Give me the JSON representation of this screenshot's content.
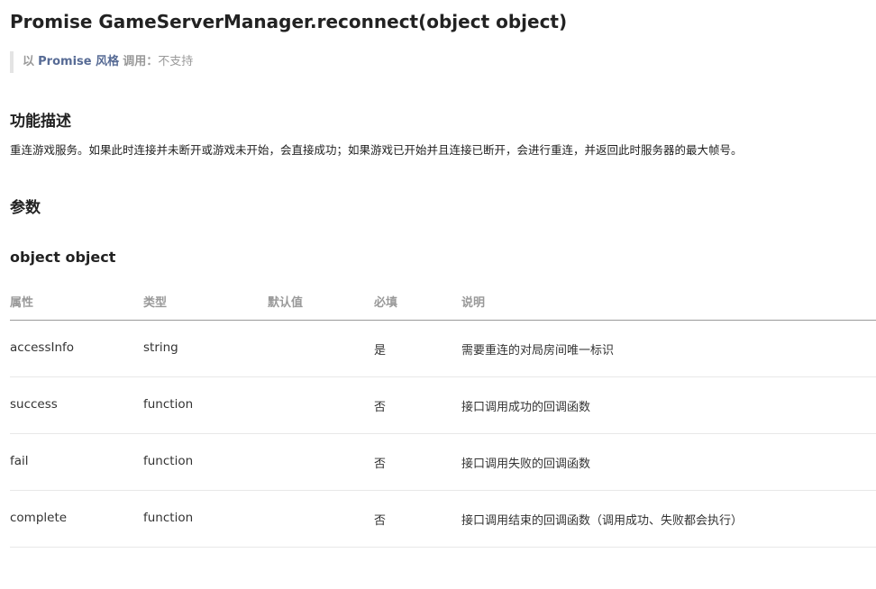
{
  "page": {
    "title": "Promise GameServerManager.reconnect(object object)",
    "promise_note": {
      "prefix": "以",
      "link": "Promise 风格",
      "label": "调用：",
      "value": "不支持"
    },
    "description_heading": "功能描述",
    "description": "重连游戏服务。如果此时连接并未断开或游戏未开始，会直接成功；如果游戏已开始并且连接已断开，会进行重连，并返回此时服务器的最大帧号。",
    "params_heading": "参数",
    "object_heading": "object object"
  },
  "table": {
    "headers": [
      "属性",
      "类型",
      "默认值",
      "必填",
      "说明"
    ],
    "rows": [
      {
        "name": "accessInfo",
        "type": "string",
        "default": "",
        "required": "是",
        "desc": "需要重连的对局房间唯一标识"
      },
      {
        "name": "success",
        "type": "function",
        "default": "",
        "required": "否",
        "desc": "接口调用成功的回调函数"
      },
      {
        "name": "fail",
        "type": "function",
        "default": "",
        "required": "否",
        "desc": "接口调用失败的回调函数"
      },
      {
        "name": "complete",
        "type": "function",
        "default": "",
        "required": "否",
        "desc": "接口调用结束的回调函数（调用成功、失败都会执行）"
      }
    ]
  }
}
